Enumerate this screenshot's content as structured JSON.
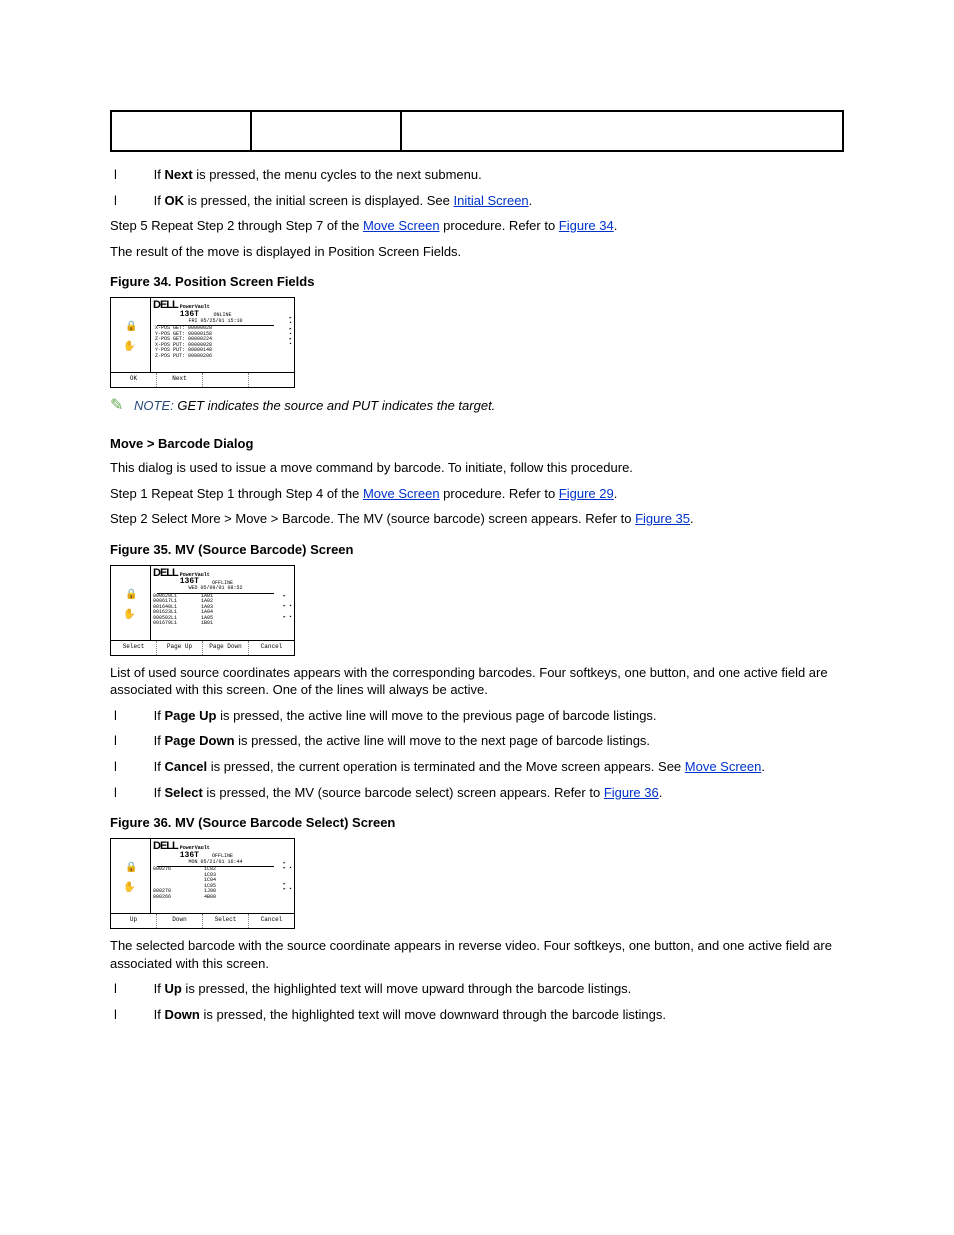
{
  "table": {
    "empty": true
  },
  "para1": [
    {
      "bullet": "l",
      "prefix": "If ",
      "action": "Next",
      "suffix": " is pressed, the menu cycles to the next submenu."
    },
    {
      "bullet": "l",
      "prefix": "If ",
      "action": "OK",
      "suffix": " is pressed, the initial screen is displayed. See ",
      "link": "Initial Screen",
      "tail": "."
    }
  ],
  "step5": {
    "text": "Step 5 Repeat Step 2 through Step 7 of the ",
    "link1": "Move Screen",
    "mid": " procedure. Refer to ",
    "link2": "Figure 34",
    "tail": "."
  },
  "posResult": "The result of the move is displayed in Position Screen Fields.",
  "fig34": {
    "caption": "Figure 34. Position Screen Fields"
  },
  "screenshot1": {
    "brand": "DELL",
    "pv": "PowerVault",
    "model": "136T",
    "status": "ONLINE",
    "date": "FRI 05/25/01 15:10",
    "rows": [
      "X-POS GET: 00000028",
      "Y-POS GET: 00000158",
      "Z-POS GET: 00000224",
      "X-POS PUT: 00000028",
      "Y-POS PUT: 00000148",
      "Z-POS PUT: 00000206"
    ],
    "buttons": [
      "OK",
      "Next",
      "",
      ""
    ]
  },
  "note1": {
    "label": "NOTE:",
    "text": " GET indicates the source and PUT indicates the target."
  },
  "barcodeHeading": "Move > Barcode Dialog",
  "barcodeIntro": "This dialog is used to issue a move command by barcode. To initiate, follow this procedure.",
  "barcodeStep1": {
    "text": "Step 1 Repeat Step 1 through Step 4 of the ",
    "link1": "Move Screen",
    "mid": " procedure. Refer to ",
    "link2": "Figure 29",
    "tail": "."
  },
  "barcodeStep2": {
    "text": "Step 2 Select More > Move > Barcode. The MV (source barcode) screen appears. Refer to ",
    "link": "Figure 35",
    "tail": "."
  },
  "fig35": {
    "caption": "Figure 35. MV (Source Barcode) Screen"
  },
  "screenshot2": {
    "brand": "DELL",
    "pv": "PowerVault",
    "model": "136T",
    "status": "OFFLINE",
    "date": "WED 05/09/01 08:52",
    "rows_left": [
      "000629L1",
      "000617L1",
      "001640L1",
      "001623L1",
      "000502L1",
      "001679L1"
    ],
    "rows_right": [
      "1A01",
      "1A02",
      "1A03",
      "1A04",
      "1A05",
      "1B01"
    ],
    "buttons": [
      "Select",
      "Page Up",
      "Page Down",
      "Cancel"
    ]
  },
  "barcodeBody": {
    "p1": "List of used source coordinates appears with the corresponding barcodes. Four softkeys, one button, and one active field are associated with this screen. One of the lines will always be active.",
    "b1": {
      "bullet": "l",
      "prefix": "If ",
      "action": "Page Up",
      "suffix": " is pressed, the active line will move to the previous page of barcode listings."
    },
    "b2": {
      "bullet": "l",
      "prefix": "If ",
      "action": "Page Down",
      "suffix": " is pressed, the active line will move to the next page of barcode listings."
    },
    "b3": {
      "bullet": "l",
      "prefix": "If ",
      "action": "Cancel",
      "suffix": " is pressed, the current operation is terminated and the Move screen appears. See ",
      "link": "Move Screen",
      "tail": "."
    },
    "b4": {
      "bullet": "l",
      "prefix": "If ",
      "action": "Select",
      "suffix": " is pressed, the MV (source barcode select) screen appears. Refer to ",
      "link": "Figure 36",
      "tail": "."
    }
  },
  "fig36": {
    "caption": "Figure 36. MV (Source Barcode Select) Screen"
  },
  "screenshot3": {
    "brand": "DELL",
    "pv": "PowerVault",
    "model": "136T",
    "status": "OFFLINE",
    "date": "MON 05/21/01 16:44",
    "group1_left": "000276",
    "group1_right": [
      "1C02",
      "1C03",
      "1C04",
      "1C05"
    ],
    "hl_left": "000270",
    "hl_right": "1J00",
    "group2_left": "000266",
    "group2_right": "4B00",
    "buttons": [
      "Up",
      "Down",
      "Select",
      "Cancel"
    ]
  },
  "selectBody": {
    "p1": "The selected barcode with the source coordinate appears in reverse video. Four softkeys, one button, and one active field are associated with this screen.",
    "b1": {
      "bullet": "l",
      "prefix": "If ",
      "action": "Up",
      "suffix": " is pressed, the highlighted text will move upward through the barcode listings."
    },
    "b2": {
      "bullet": "l",
      "prefix": "If ",
      "action": "Down",
      "suffix": " is pressed, the highlighted text will move downward through the barcode listings."
    }
  }
}
